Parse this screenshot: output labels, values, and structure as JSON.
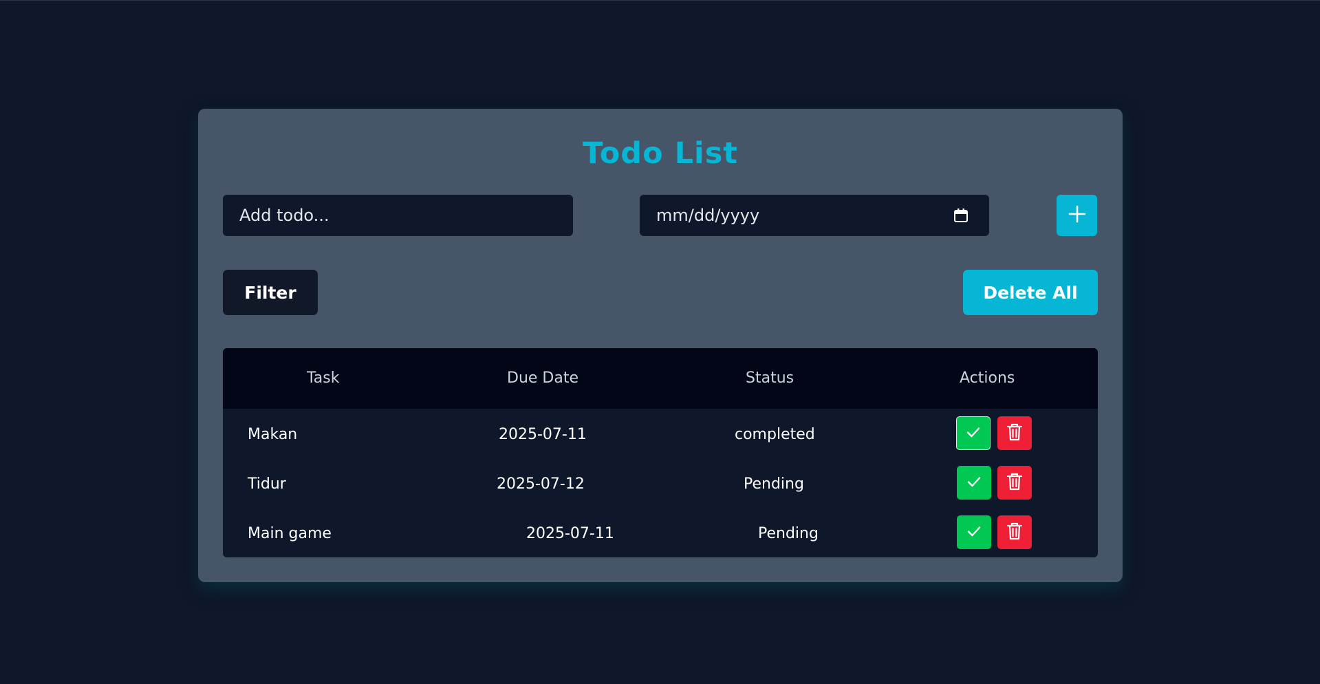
{
  "app": {
    "title": "Todo List"
  },
  "form": {
    "todo_placeholder": "Add todo...",
    "date_placeholder": "mm/dd/yyyy",
    "add_icon": "plus-icon",
    "calendar_icon": "calendar-icon"
  },
  "toolbar": {
    "filter_label": "Filter",
    "delete_all_label": "Delete All"
  },
  "table": {
    "headers": [
      "Task",
      "Due Date",
      "Status",
      "Actions"
    ],
    "rows": [
      {
        "task": "Makan",
        "due": "2025-07-11",
        "status": "completed"
      },
      {
        "task": "Tidur",
        "due": "2025-07-12",
        "status": "Pending"
      },
      {
        "task": "Main game",
        "due": "2025-07-11",
        "status": "Pending"
      }
    ]
  },
  "colors": {
    "background": "#0f172a",
    "card": "#475569",
    "accent": "#06b6d4",
    "complete": "#00c853",
    "danger": "#ef1f35"
  }
}
